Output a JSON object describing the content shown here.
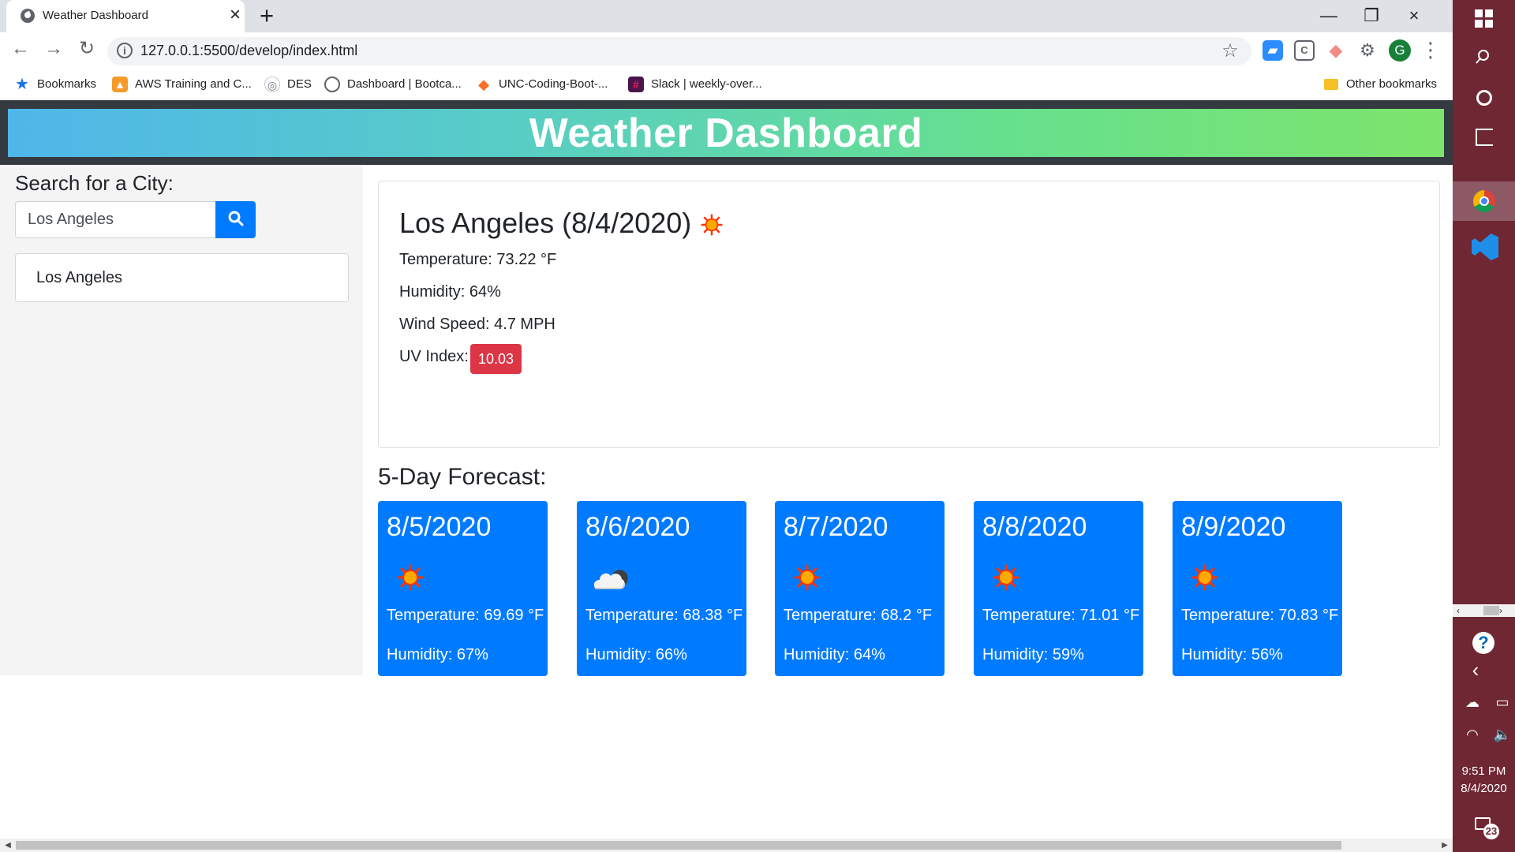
{
  "browser": {
    "tab_title": "Weather Dashboard",
    "close_tab_glyph": "×",
    "new_tab_glyph": "+",
    "window_controls": [
      "—",
      "❐",
      "×"
    ],
    "url": "127.0.0.1:5500/develop/index.html",
    "bookmarks": [
      {
        "label": "Bookmarks",
        "icon": "star-icon"
      },
      {
        "label": "AWS Training and C...",
        "icon": "aws-icon"
      },
      {
        "label": "DES",
        "icon": "globe-icon"
      },
      {
        "label": "Dashboard | Bootca...",
        "icon": "globe-icon"
      },
      {
        "label": "UNC-Coding-Boot-...",
        "icon": "gitlab-icon"
      },
      {
        "label": "Slack | weekly-over...",
        "icon": "slack-icon"
      }
    ],
    "other_bookmarks": "Other bookmarks",
    "profile_initial": "G"
  },
  "app": {
    "title": "Weather Dashboard",
    "search": {
      "heading": "Search for a City:",
      "value": "Los Angeles",
      "button_icon": "search-icon"
    },
    "history": [
      "Los Angeles"
    ],
    "current": {
      "title": "Los Angeles (8/4/2020)",
      "icon": "sunny-icon",
      "temperature": "Temperature: 73.22 °F",
      "humidity": "Humidity: 64%",
      "wind": "Wind Speed: 4.7 MPH",
      "uv_label": "UV Index:",
      "uv_value": "10.03"
    },
    "forecast_heading": "5-Day Forecast:",
    "forecast": [
      {
        "date": "8/5/2020",
        "icon": "sunny-icon",
        "temperature": "Temperature: 69.69 °F",
        "humidity": "Humidity: 67%"
      },
      {
        "date": "8/6/2020",
        "icon": "partly-cloudy-night-icon",
        "temperature": "Temperature: 68.38 °F",
        "humidity": "Humidity: 66%"
      },
      {
        "date": "8/7/2020",
        "icon": "sunny-icon",
        "temperature": "Temperature: 68.2 °F",
        "humidity": "Humidity: 64%"
      },
      {
        "date": "8/8/2020",
        "icon": "sunny-icon",
        "temperature": "Temperature: 71.01 °F",
        "humidity": "Humidity: 59%"
      },
      {
        "date": "8/9/2020",
        "icon": "sunny-icon",
        "temperature": "Temperature: 70.83 °F",
        "humidity": "Humidity: 56%"
      }
    ]
  },
  "system": {
    "time": "9:51 PM",
    "date": "8/4/2020",
    "notification_count": "23"
  },
  "colors": {
    "primary": "#007bff",
    "danger": "#dc3545",
    "header_dark": "#343a40",
    "taskbar": "#6f2734"
  }
}
